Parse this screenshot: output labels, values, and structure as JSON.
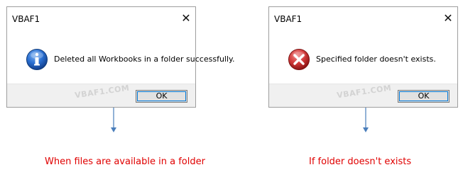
{
  "dialogs": [
    {
      "title": "VBAF1",
      "close_glyph": "✕",
      "icon": "info-icon",
      "message": "Deleted all Workbooks in a folder successfully.",
      "ok_label": "OK",
      "watermark": "VBAF1.COM"
    },
    {
      "title": "VBAF1",
      "close_glyph": "✕",
      "icon": "error-icon",
      "message": "Specified folder doesn't exists.",
      "ok_label": "OK",
      "watermark": "VBAF1.COM"
    }
  ],
  "captions": {
    "left": "When files are available in a folder",
    "right": "If folder doesn't exists"
  },
  "colors": {
    "caption": "#e00000",
    "arrow": "#4a7ebb",
    "info_icon": "#1b5fc4",
    "error_icon": "#c83030"
  }
}
